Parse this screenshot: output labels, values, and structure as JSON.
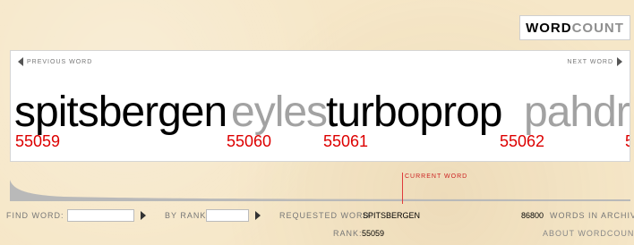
{
  "logo": {
    "part1": "WORD",
    "part2": "COUNT"
  },
  "nav": {
    "previous_label": "PREVIOUS WORD",
    "next_label": "NEXT WORD"
  },
  "words": [
    {
      "word": "spitsbergen",
      "rank": "55059",
      "state": "current"
    },
    {
      "word": "eyles",
      "rank": "55060",
      "state": "dim"
    },
    {
      "word": "turboprop",
      "rank": "55061",
      "state": "current"
    },
    {
      "word": "pahdra",
      "rank": "55062",
      "state": "dim"
    }
  ],
  "indicator": {
    "label": "CURRENT WORD"
  },
  "controls": {
    "find_label": "FIND WORD:",
    "find_value": "",
    "rank_label": "BY RANK:",
    "rank_value": "",
    "requested_label": "REQUESTED WORD:",
    "requested_value": "SPITSBERGEN",
    "rank_info_label": "RANK:",
    "rank_info_value": "55059"
  },
  "archive": {
    "count": "86800",
    "label": "WORDS IN ARCHIVE"
  },
  "about_link": "ABOUT WORDCOUNT",
  "colors": {
    "rank": "#dd0000",
    "dim_word": "#a2a2a2",
    "background": "#f6e7c8"
  }
}
